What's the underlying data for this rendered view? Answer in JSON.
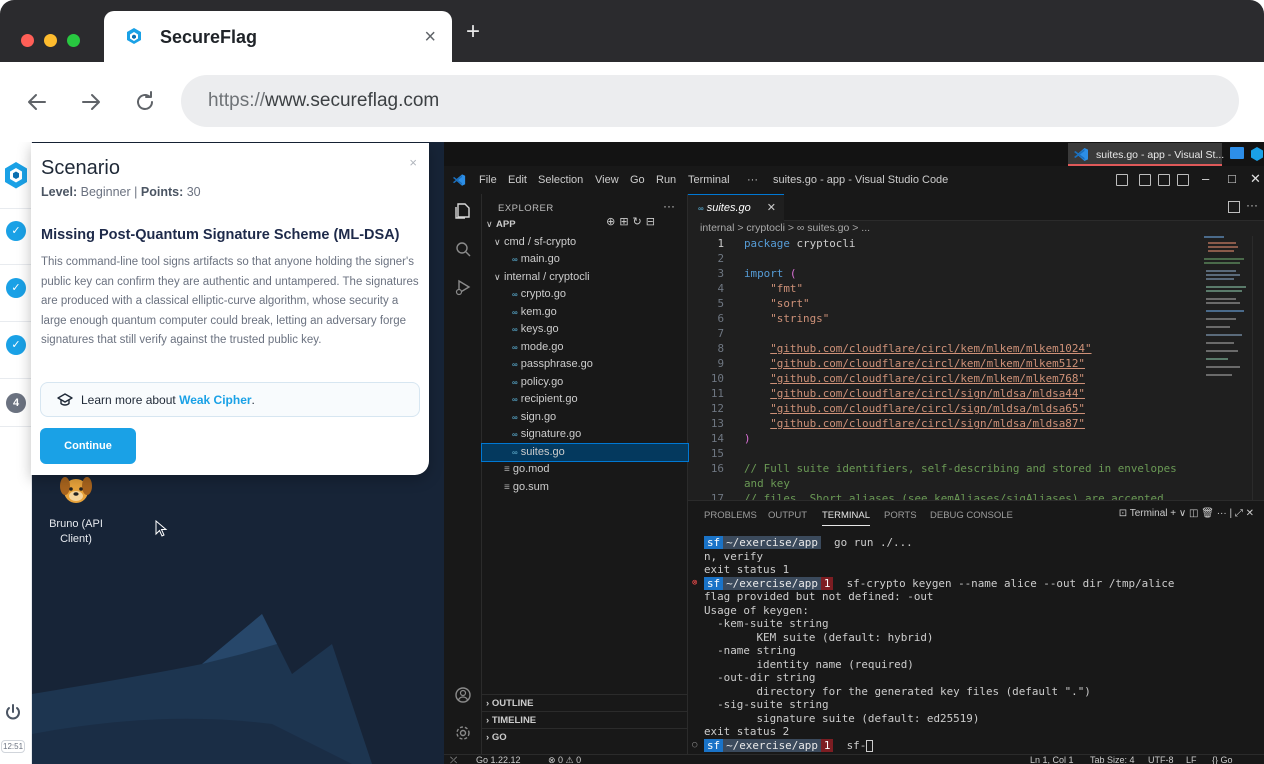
{
  "browser": {
    "tab_title": "SecureFlag",
    "tab_close": "×",
    "new_tab": "+",
    "url_protocol": "https://",
    "url_host": "www.secureflag.com"
  },
  "sidebar": {
    "steps": [
      {
        "label": "✓",
        "state": "done"
      },
      {
        "label": "✓",
        "state": "done"
      },
      {
        "label": "✓",
        "state": "done"
      },
      {
        "label": "4",
        "state": "current"
      }
    ],
    "clock": "12:51"
  },
  "scenario": {
    "title": "Scenario",
    "close": "×",
    "level_label": "Level:",
    "level_value": "Beginner",
    "separator": "|",
    "points_label": "Points:",
    "points_value": "30",
    "heading": "Missing Post-Quantum Signature Scheme (ML-DSA)",
    "body": "This command-line tool signs artifacts so that anyone holding the signer's public key can confirm they are authentic and untampered. The signatures are produced with a classical elliptic-curve algorithm, whose security a large enough quantum computer could break, letting an adversary forge signatures that still verify against the trusted public key.",
    "learn_prefix": "Learn more about",
    "learn_link": "Weak Cipher",
    "learn_suffix": ".",
    "continue_label": "Continue"
  },
  "desktop": {
    "bruno_label": "Bruno (API Client)"
  },
  "vm_taskbar": {
    "task_label": "suites.go - app - Visual St..."
  },
  "vscode": {
    "menu": [
      "File",
      "Edit",
      "Selection",
      "View",
      "Go",
      "Run",
      "Terminal",
      "···"
    ],
    "window_title": "suites.go - app - Visual Studio Code",
    "explorer_title": "EXPLORER",
    "explorer_dots": "···",
    "tree": [
      {
        "label": "APP",
        "indent": 0,
        "chev": "∨",
        "type": "root"
      },
      {
        "label": "cmd / sf-crypto",
        "indent": 1,
        "chev": "∨",
        "type": "folder"
      },
      {
        "label": "main.go",
        "indent": 2,
        "chev": "",
        "type": "go"
      },
      {
        "label": "internal / cryptocli",
        "indent": 1,
        "chev": "∨",
        "type": "folder"
      },
      {
        "label": "crypto.go",
        "indent": 2,
        "chev": "",
        "type": "go"
      },
      {
        "label": "kem.go",
        "indent": 2,
        "chev": "",
        "type": "go"
      },
      {
        "label": "keys.go",
        "indent": 2,
        "chev": "",
        "type": "go"
      },
      {
        "label": "mode.go",
        "indent": 2,
        "chev": "",
        "type": "go"
      },
      {
        "label": "passphrase.go",
        "indent": 2,
        "chev": "",
        "type": "go"
      },
      {
        "label": "policy.go",
        "indent": 2,
        "chev": "",
        "type": "go"
      },
      {
        "label": "recipient.go",
        "indent": 2,
        "chev": "",
        "type": "go"
      },
      {
        "label": "sign.go",
        "indent": 2,
        "chev": "",
        "type": "go"
      },
      {
        "label": "signature.go",
        "indent": 2,
        "chev": "",
        "type": "go"
      },
      {
        "label": "suites.go",
        "indent": 2,
        "chev": "",
        "type": "go",
        "selected": true
      },
      {
        "label": "go.mod",
        "indent": 1,
        "chev": "",
        "type": "mod"
      },
      {
        "label": "go.sum",
        "indent": 1,
        "chev": "",
        "type": "mod"
      }
    ],
    "sections": [
      "OUTLINE",
      "TIMELINE",
      "GO"
    ],
    "editor_tab": "suites.go",
    "editor_tab_close": "✕",
    "breadcrumb": "internal > cryptocli > ∞ suites.go > ...",
    "code": [
      {
        "n": "1",
        "parts": [
          {
            "c": "kw",
            "t": "package"
          },
          {
            "c": "plain",
            "t": " cryptocli"
          }
        ]
      },
      {
        "n": "2",
        "parts": []
      },
      {
        "n": "3",
        "parts": [
          {
            "c": "kw",
            "t": "import"
          },
          {
            "c": "plain",
            "t": " "
          },
          {
            "c": "punc",
            "t": "("
          }
        ]
      },
      {
        "n": "4",
        "parts": [
          {
            "c": "plain",
            "t": "    "
          },
          {
            "c": "str",
            "t": "\"fmt\""
          }
        ]
      },
      {
        "n": "5",
        "parts": [
          {
            "c": "plain",
            "t": "    "
          },
          {
            "c": "str",
            "t": "\"sort\""
          }
        ]
      },
      {
        "n": "6",
        "parts": [
          {
            "c": "plain",
            "t": "    "
          },
          {
            "c": "str",
            "t": "\"strings\""
          }
        ]
      },
      {
        "n": "7",
        "parts": []
      },
      {
        "n": "8",
        "parts": [
          {
            "c": "plain",
            "t": "    "
          },
          {
            "c": "str-u",
            "t": "\"github.com/cloudflare/circl/kem/mlkem/mlkem1024\""
          }
        ]
      },
      {
        "n": "9",
        "parts": [
          {
            "c": "plain",
            "t": "    "
          },
          {
            "c": "str-u",
            "t": "\"github.com/cloudflare/circl/kem/mlkem/mlkem512\""
          }
        ]
      },
      {
        "n": "10",
        "parts": [
          {
            "c": "plain",
            "t": "    "
          },
          {
            "c": "str-u",
            "t": "\"github.com/cloudflare/circl/kem/mlkem/mlkem768\""
          }
        ]
      },
      {
        "n": "11",
        "parts": [
          {
            "c": "plain",
            "t": "    "
          },
          {
            "c": "str-u",
            "t": "\"github.com/cloudflare/circl/sign/mldsa/mldsa44\""
          }
        ]
      },
      {
        "n": "12",
        "parts": [
          {
            "c": "plain",
            "t": "    "
          },
          {
            "c": "str-u",
            "t": "\"github.com/cloudflare/circl/sign/mldsa/mldsa65\""
          }
        ]
      },
      {
        "n": "13",
        "parts": [
          {
            "c": "plain",
            "t": "    "
          },
          {
            "c": "str-u",
            "t": "\"github.com/cloudflare/circl/sign/mldsa/mldsa87\""
          }
        ]
      },
      {
        "n": "14",
        "parts": [
          {
            "c": "punc",
            "t": ")"
          }
        ]
      },
      {
        "n": "15",
        "parts": []
      },
      {
        "n": "16",
        "parts": [
          {
            "c": "cmt",
            "t": "// Full suite identifiers, self-describing and stored in envelopes"
          }
        ]
      },
      {
        "n": "",
        "parts": [
          {
            "c": "cmt",
            "t": "and key"
          }
        ]
      },
      {
        "n": "17",
        "parts": [
          {
            "c": "cmt",
            "t": "// files. Short aliases (see kemAliases/sigAliases) are accepted"
          }
        ]
      }
    ],
    "panel_tabs": [
      "PROBLEMS",
      "OUTPUT",
      "TERMINAL",
      "PORTS",
      "DEBUG CONSOLE"
    ],
    "panel_active": "TERMINAL",
    "panel_tools": "⊡ Terminal  + ∨  ◫  🗑  ···  |  ⤢  ✕",
    "terminal": [
      {
        "type": "prompt",
        "sf": "sf",
        "path": "~/exercise/app",
        "err": "",
        "cmd": "go run ./..."
      },
      {
        "type": "text",
        "text": "n, verify"
      },
      {
        "type": "text",
        "text": "exit status 1"
      },
      {
        "type": "prompt",
        "sf": "sf",
        "path": "~/exercise/app",
        "err": "1",
        "cmd": "sf-crypto keygen --name alice --out dir /tmp/alice",
        "bullet": "⊗"
      },
      {
        "type": "text",
        "text": "flag provided but not defined: -out"
      },
      {
        "type": "text",
        "text": "Usage of keygen:"
      },
      {
        "type": "text",
        "text": "  -kem-suite string"
      },
      {
        "type": "text",
        "text": "        KEM suite (default: hybrid)"
      },
      {
        "type": "text",
        "text": "  -name string"
      },
      {
        "type": "text",
        "text": "        identity name (required)"
      },
      {
        "type": "text",
        "text": "  -out-dir string"
      },
      {
        "type": "text",
        "text": "        directory for the generated key files (default \".\")"
      },
      {
        "type": "text",
        "text": "  -sig-suite string"
      },
      {
        "type": "text",
        "text": "        signature suite (default: ed25519)"
      },
      {
        "type": "text",
        "text": "exit status 2"
      },
      {
        "type": "prompt",
        "sf": "sf",
        "path": "~/exercise/app",
        "err": "1",
        "cmd": "sf-",
        "bullet": "○",
        "cursor": true
      }
    ],
    "status": {
      "go_version": "Go 1.22.12",
      "problems": "⊗ 0 ⚠ 0",
      "position": "Ln 1, Col 1",
      "tab_size": "Tab Size: 4",
      "encoding": "UTF-8",
      "eol": "LF",
      "lang": "{} Go"
    }
  },
  "colors": {
    "accent": "#1aa1e6",
    "desktop_bg": "#172437",
    "vscode_bg": "#1f1f1f"
  }
}
